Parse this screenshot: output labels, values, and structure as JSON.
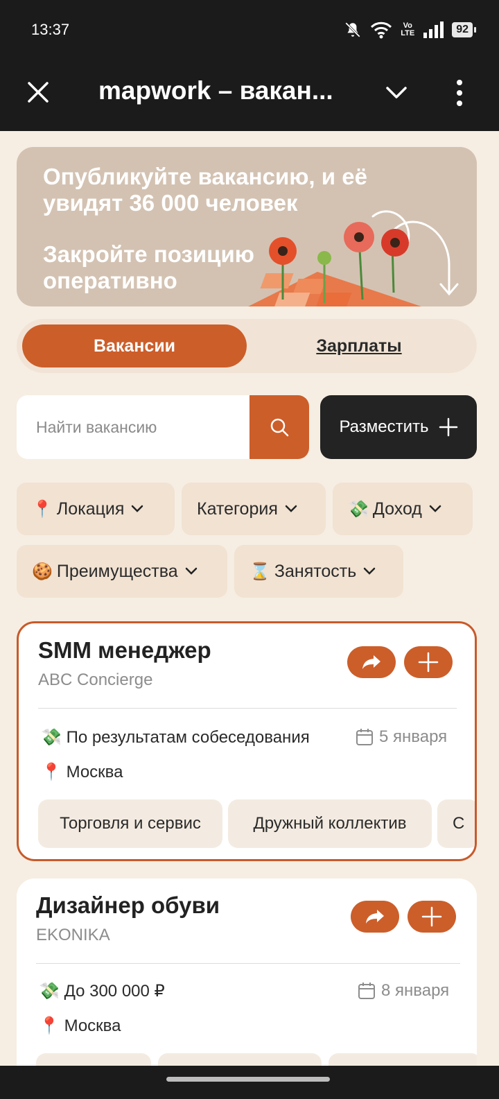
{
  "status_bar": {
    "time": "13:37",
    "volte": [
      "Vo",
      "LTE"
    ],
    "battery": "92",
    "icons": [
      "bell-off-icon",
      "wifi-icon",
      "volte-icon",
      "signal-icon",
      "battery-icon"
    ]
  },
  "app_bar": {
    "title": "mapwork – вакан...",
    "close_icon": "close-icon",
    "expand_icon": "chevron-down-icon",
    "menu_icon": "more-vertical-icon"
  },
  "banner": {
    "line1": "Опубликуйте вакансию, и её увидят 36 000 человек",
    "line2": "Закройте позицию оперативно"
  },
  "tabs": {
    "active": "Вакансии",
    "inactive": "Зарплаты"
  },
  "search": {
    "placeholder": "Найти вакансию",
    "post_label": "Разместить"
  },
  "filters": [
    {
      "emoji": "📍",
      "label": "Локация"
    },
    {
      "emoji": "",
      "label": "Категория"
    },
    {
      "emoji": "💸",
      "label": "Доход"
    },
    {
      "emoji": "🍪",
      "label": "Преимущества"
    },
    {
      "emoji": "⌛",
      "label": "Занятость"
    }
  ],
  "jobs": [
    {
      "title": "SMM менеджер",
      "company": "ABC Concierge",
      "salary_emoji": "💸",
      "salary": "По результатам собеседования",
      "date": "5 января",
      "city_emoji": "📍",
      "city": "Москва",
      "tags": [
        "Торговля и сервис",
        "Дружный коллектив",
        "С"
      ]
    },
    {
      "title": "Дизайнер обуви",
      "company": "EKONIKA",
      "salary_emoji": "💸",
      "salary": "До 300 000 ₽",
      "date": "8 января",
      "city_emoji": "📍",
      "city": "Москва",
      "tags": []
    }
  ],
  "colors": {
    "accent": "#cc5e2a",
    "background": "#f6eee3",
    "dark": "#1b1b1b"
  }
}
